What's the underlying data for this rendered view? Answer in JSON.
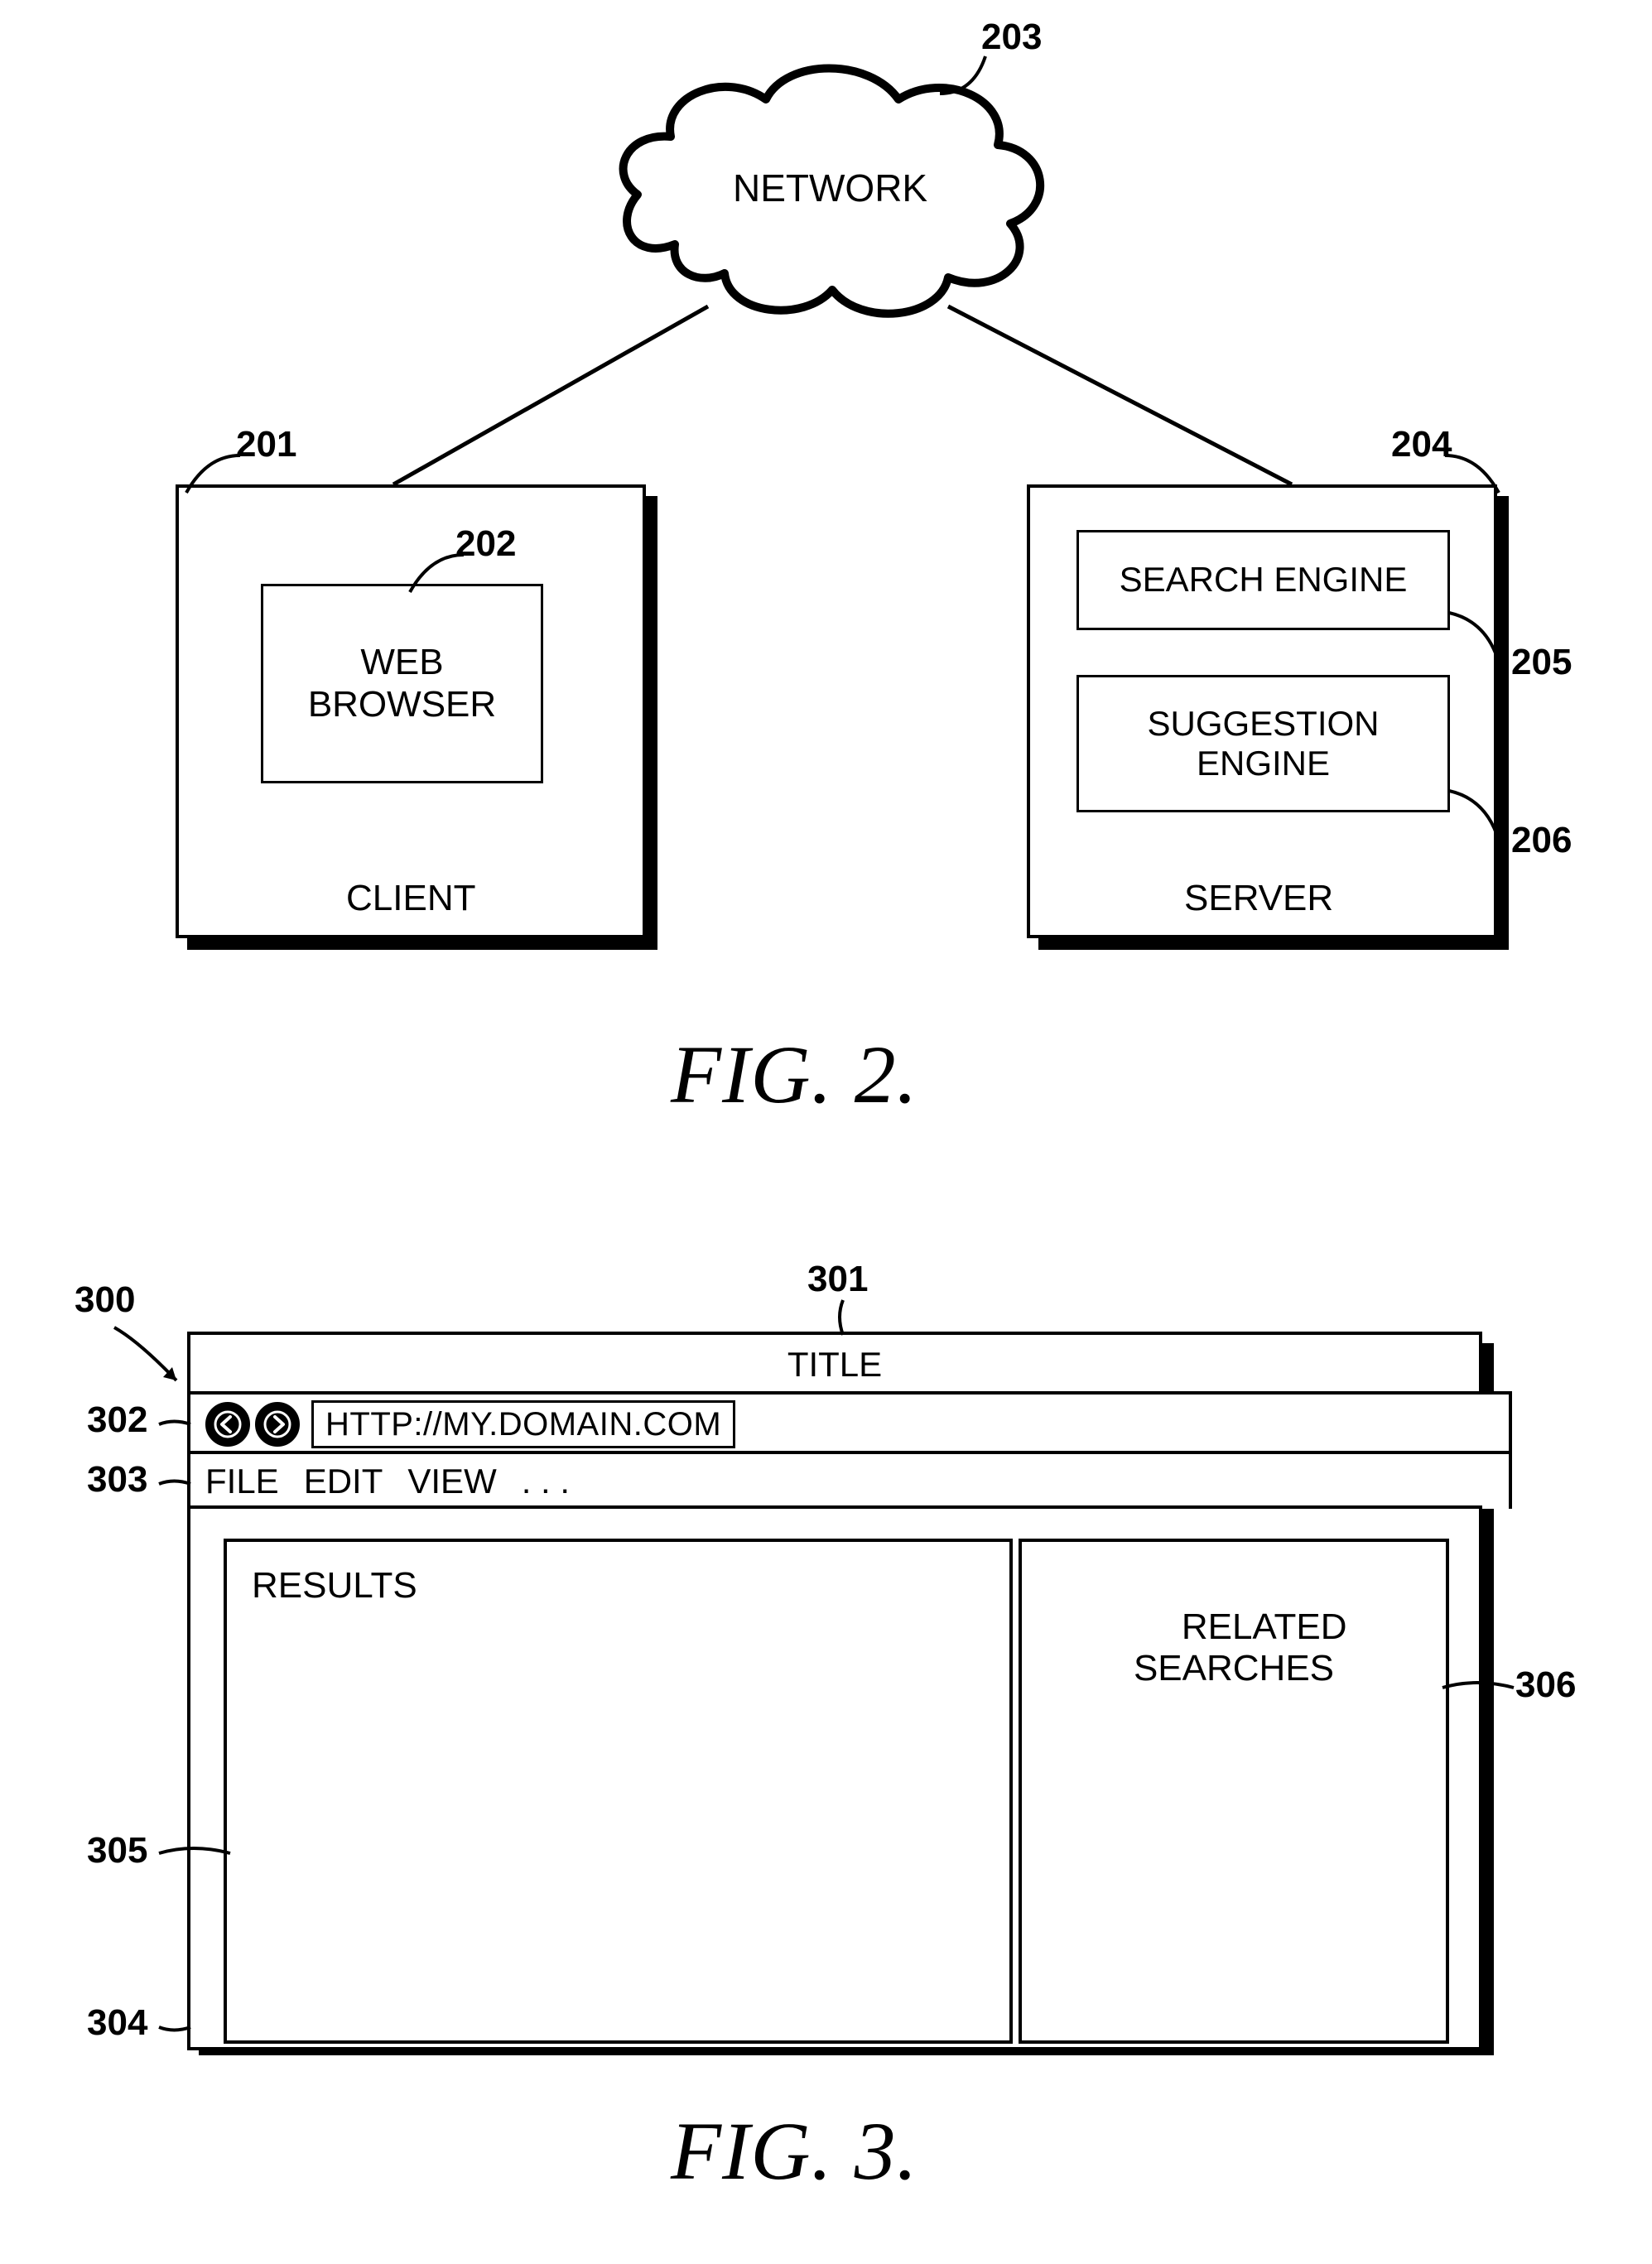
{
  "fig2": {
    "caption": "FIG. 2.",
    "network": {
      "label": "NETWORK",
      "ref": "203"
    },
    "client": {
      "ref": "201",
      "caption": "CLIENT",
      "webBrowser": {
        "label": "WEB\nBROWSER",
        "ref": "202"
      }
    },
    "server": {
      "ref": "204",
      "caption": "SERVER",
      "searchEngine": {
        "label": "SEARCH ENGINE",
        "ref": "205"
      },
      "suggestionEngine": {
        "label": "SUGGESTION\nENGINE",
        "ref": "206"
      }
    }
  },
  "fig3": {
    "caption": "FIG. 3.",
    "windowRef": "300",
    "titleBar": {
      "text": "TITLE",
      "ref": "301"
    },
    "toolbar": {
      "ref": "302",
      "url": "HTTP://MY.DOMAIN.COM"
    },
    "menuBar": {
      "ref": "303",
      "items": [
        "FILE",
        "EDIT",
        "VIEW",
        ". . ."
      ]
    },
    "contentRef": "304",
    "resultsPane": {
      "label": "RESULTS",
      "ref": "305"
    },
    "relatedPane": {
      "label": "RELATED\nSEARCHES",
      "ref": "306"
    }
  }
}
